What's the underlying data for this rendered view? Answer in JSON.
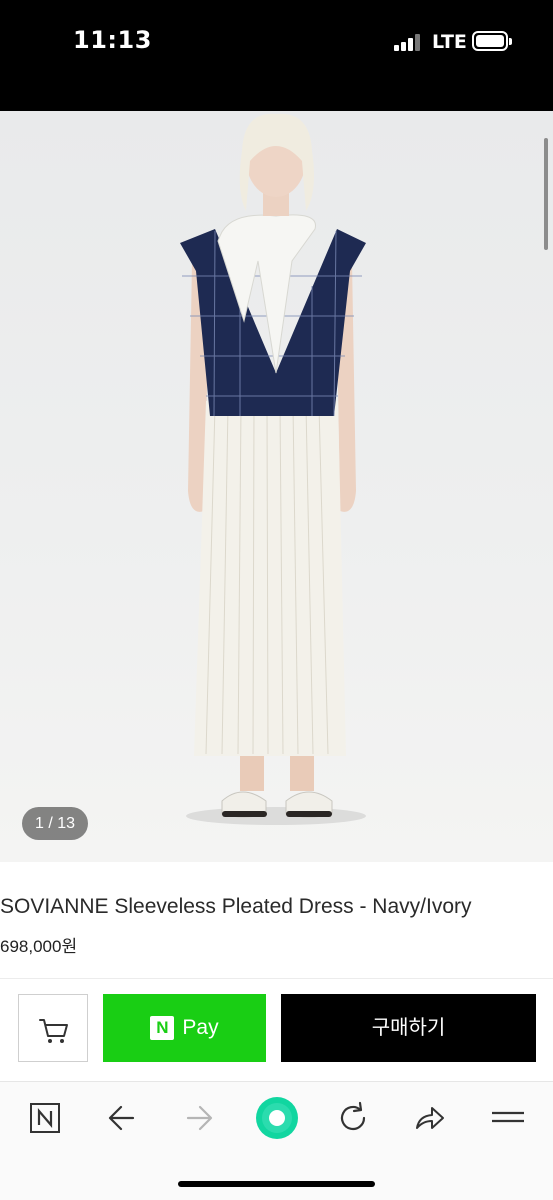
{
  "status_bar": {
    "time": "11:13",
    "network": "LTE"
  },
  "product": {
    "image_counter": "1 / 13",
    "title": "SOVIANNE Sleeveless Pleated Dress - Navy/Ivory",
    "price": "698,000원"
  },
  "actions": {
    "cart_icon": "cart-icon",
    "npay_logo": "N",
    "npay_label": "Pay",
    "purchase_label": "구매하기"
  },
  "browser_nav": {
    "icons": [
      "naver-home-icon",
      "back-arrow-icon",
      "forward-arrow-icon",
      "green-dot-menu-icon",
      "reload-icon",
      "share-icon",
      "menu-icon"
    ]
  },
  "colors": {
    "npay_green": "#19ce14",
    "navy": "#1e2a52",
    "ivory": "#f3f1ea"
  }
}
